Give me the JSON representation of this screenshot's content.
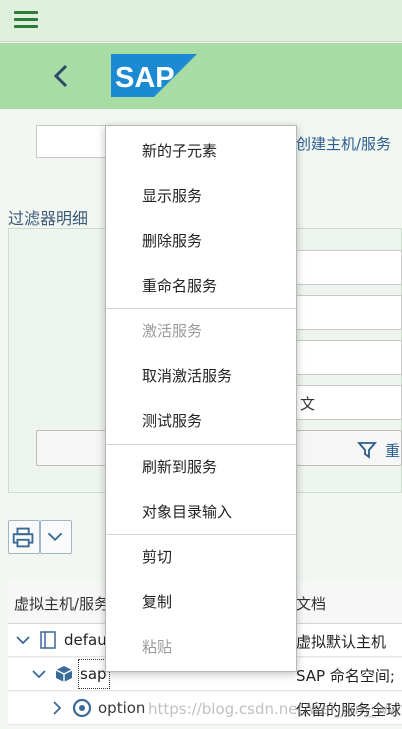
{
  "header": {
    "logo_text": "SAP",
    "colors": {
      "topbar": "#dff0dc",
      "header": "#a8dca5",
      "logo": "#1b8ad3",
      "accent": "#2f7a3c"
    }
  },
  "toolbar": {
    "create_link": "创建主机/服务"
  },
  "filter": {
    "title": "过滤器明细",
    "text_value": "文",
    "apply_button": "重"
  },
  "grid": {
    "columns": [
      "虚拟主机/服务",
      "文档"
    ],
    "rows": [
      {
        "name": "defau",
        "doc": "虚拟默认主机"
      },
      {
        "name": "sap",
        "doc": "SAP 命名空间;"
      },
      {
        "name": "option",
        "doc": "保留的服务全球"
      }
    ]
  },
  "context_menu": {
    "items": [
      {
        "label": "新的子元素",
        "disabled": false
      },
      {
        "label": "显示服务",
        "disabled": false
      },
      {
        "label": "删除服务",
        "disabled": false
      },
      {
        "label": "重命名服务",
        "disabled": false
      },
      {
        "label": "激活服务",
        "disabled": true
      },
      {
        "label": "取消激活服务",
        "disabled": false
      },
      {
        "label": "测试服务",
        "disabled": false
      },
      {
        "label": "刷新到服务",
        "disabled": false
      },
      {
        "label": "对象目录输入",
        "disabled": false
      },
      {
        "label": "剪切",
        "disabled": false
      },
      {
        "label": "复制",
        "disabled": false
      },
      {
        "label": "粘贴",
        "disabled": true
      }
    ]
  },
  "watermark": "https://blog.csdn.net/wei_sun_www"
}
